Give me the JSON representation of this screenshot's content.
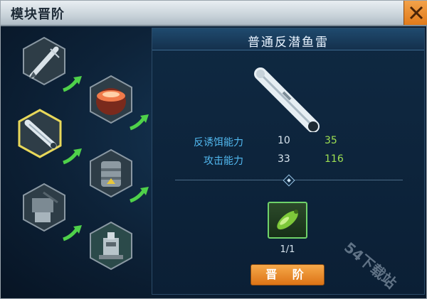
{
  "window": {
    "title": "模块晋阶"
  },
  "module": {
    "name": "普通反潜鱼雷"
  },
  "stats": [
    {
      "label": "反诱饵能力",
      "current": "10",
      "next": "35"
    },
    {
      "label": "攻击能力",
      "current": "33",
      "next": "116"
    }
  ],
  "cost": {
    "count": "1/1"
  },
  "actions": {
    "upgrade_label": "晋 阶"
  },
  "watermark": "54下载站",
  "colors": {
    "accent": "#f0901e",
    "label_blue": "#52b9f0",
    "next_green": "#9ee052",
    "selected_border": "#e8d85a"
  },
  "modules_list": [
    {
      "icon": "missile-icon"
    },
    {
      "icon": "radar-dome-icon"
    },
    {
      "icon": "torpedo-icon",
      "selected": true
    },
    {
      "icon": "reactor-icon"
    },
    {
      "icon": "turret-icon"
    },
    {
      "icon": "machinery-icon"
    }
  ]
}
